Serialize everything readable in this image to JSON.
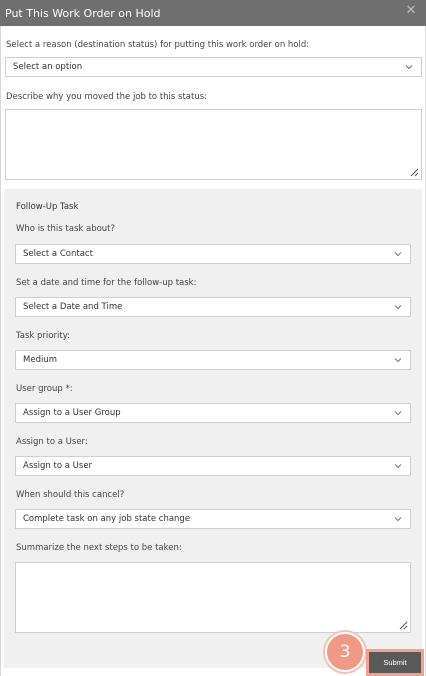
{
  "dialog": {
    "title": "Put This Work Order on Hold",
    "reason_label": "Select a reason (destination status) for putting this work order on hold:",
    "reason_value": "Select an option",
    "describe_label": "Describe why you moved the job to this status:"
  },
  "followup": {
    "title": "Follow-Up Task",
    "contact_label": "Who is this task about?",
    "contact_value": "Select a Contact",
    "datetime_label": "Set a date and time for the follow-up task:",
    "datetime_value": "Select a Date and Time",
    "priority_label": "Task priority:",
    "priority_value": "Medium",
    "usergroup_label": "User group *:",
    "usergroup_value": "Assign to a User Group",
    "user_label": "Assign to a User:",
    "user_value": "Assign to a User",
    "cancel_label": "When should this cancel?",
    "cancel_value": "Complete task on any job state change",
    "summary_label": "Summarize the next steps to be taken:"
  },
  "step_badge": "3",
  "submit_label": "Submit",
  "colors": {
    "titlebar": "#6f6f6f",
    "panel": "#f0f0f0",
    "badge": "#f09a86",
    "submit": "#595959",
    "submit_highlight": "#f4a08c"
  },
  "icons": {
    "close": "close-icon",
    "dropdown": "chevron-down-icon",
    "resize": "resize-grip-icon"
  }
}
